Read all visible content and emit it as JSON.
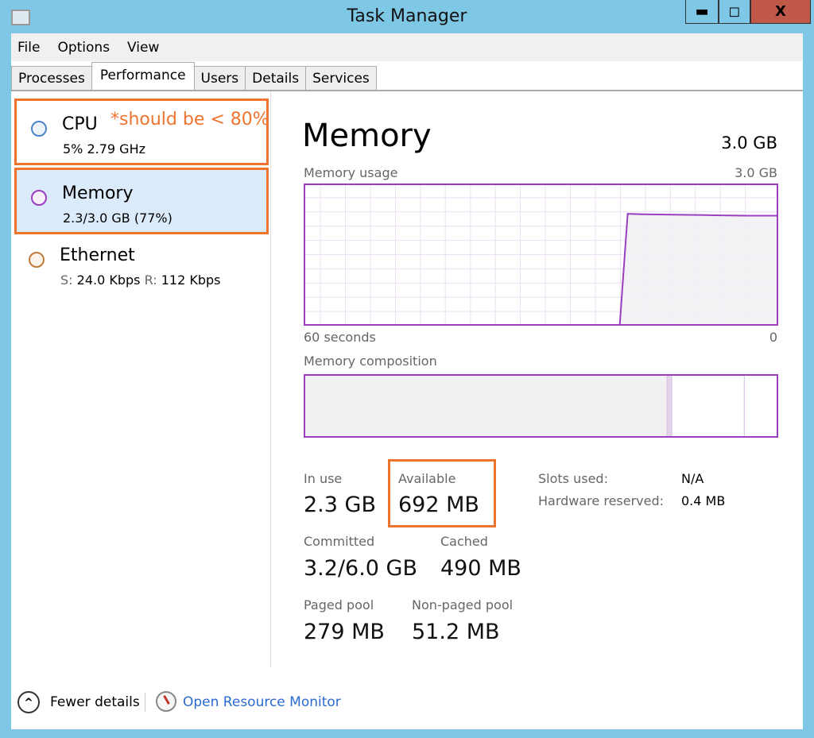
{
  "window": {
    "title": "Task Manager",
    "minimize": "▬",
    "maximize": "◻",
    "close": "X",
    "close_color": "#c0594a"
  },
  "menu": [
    "File",
    "Options",
    "View"
  ],
  "tabs": [
    {
      "label": "Processes"
    },
    {
      "label": "Performance",
      "active": true
    },
    {
      "label": "Users"
    },
    {
      "label": "Details"
    },
    {
      "label": "Services"
    }
  ],
  "sidebar": {
    "items": [
      {
        "name": "CPU",
        "sub": "5% 2.79 GHz",
        "color": "#4a86c8"
      },
      {
        "name": "Memory",
        "sub": "2.3/3.0 GB (77%)",
        "color": "#9b3fc0",
        "selected": true
      },
      {
        "name": "Ethernet",
        "sub_s_label": "S:",
        "sub_s": "24.0 Kbps",
        "sub_r_label": "R:",
        "sub_r": "112 Kbps",
        "color": "#c07a3a"
      }
    ]
  },
  "annotation": {
    "text": "*should be < 80%",
    "color": "#ee7430"
  },
  "main": {
    "title": "Memory",
    "total": "3.0 GB",
    "usage_label": "Memory usage",
    "usage_max": "3.0 GB",
    "time_left": "60 seconds",
    "time_right": "0",
    "composition_label": "Memory composition",
    "stats": {
      "in_use_label": "In use",
      "in_use": "2.3 GB",
      "available_label": "Available",
      "available": "692 MB",
      "committed_label": "Committed",
      "committed": "3.2/6.0 GB",
      "cached_label": "Cached",
      "cached": "490 MB",
      "paged_label": "Paged pool",
      "paged": "279 MB",
      "nonpaged_label": "Non-paged pool",
      "nonpaged": "51.2 MB",
      "slots_label": "Slots used:",
      "slots": "N/A",
      "hw_label": "Hardware reserved:",
      "hw": "0.4 MB"
    }
  },
  "footer": {
    "fewer": "Fewer details",
    "resmon": "Open Resource Monitor"
  },
  "chart_data": {
    "type": "area",
    "title": "Memory usage",
    "xlabel_left": "60 seconds",
    "xlabel_right": "0",
    "x_seconds_ago": [
      60,
      21,
      20,
      19,
      17,
      12,
      8,
      4,
      0
    ],
    "values_gb": [
      0,
      0,
      0,
      2.37,
      2.36,
      2.35,
      2.34,
      2.33,
      2.33
    ],
    "ylim": [
      0,
      3.0
    ],
    "xlim": [
      60,
      0
    ],
    "grid": true,
    "color": "#9b3fc0",
    "composition_gb": {
      "in_use": 2.3,
      "modified": 0.03,
      "standby": 0.46,
      "free": 0.21
    }
  }
}
